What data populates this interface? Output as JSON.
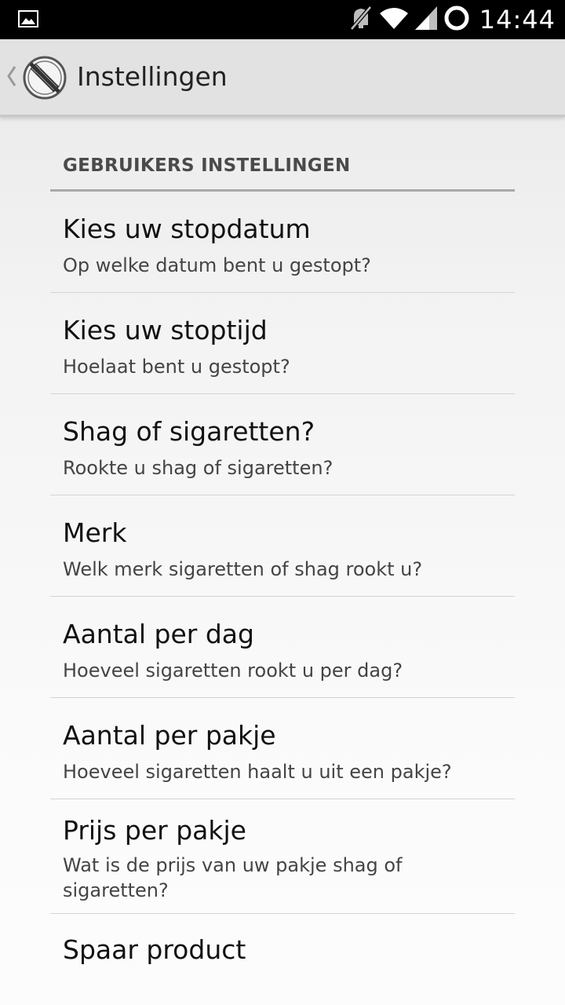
{
  "status_bar": {
    "time": "14:44",
    "icons": [
      "image-notification-icon",
      "mute-icon",
      "wifi-icon",
      "signal-icon",
      "sync-ring-icon"
    ]
  },
  "action_bar": {
    "title": "Instellingen",
    "logo_icon": "no-smoking-icon"
  },
  "category": {
    "title": "GEBRUIKERS INSTELLINGEN"
  },
  "preferences": [
    {
      "title": "Kies uw stopdatum",
      "summary": "Op welke datum bent u gestopt?"
    },
    {
      "title": "Kies uw stoptijd",
      "summary": "Hoelaat bent u gestopt?"
    },
    {
      "title": "Shag of sigaretten?",
      "summary": "Rookte u shag of sigaretten?"
    },
    {
      "title": "Merk",
      "summary": "Welk merk sigaretten of shag rookt u?"
    },
    {
      "title": "Aantal per dag",
      "summary": "Hoeveel sigaretten rookt u per dag?"
    },
    {
      "title": "Aantal per pakje",
      "summary": "Hoeveel sigaretten haalt u uit een pakje?"
    },
    {
      "title": "Prijs per pakje",
      "summary": "Wat is de prijs van uw pakje shag of sigaretten?"
    },
    {
      "title": "Spaar product"
    }
  ]
}
